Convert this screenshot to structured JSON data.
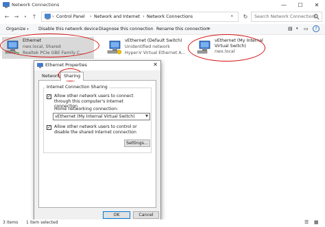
{
  "window": {
    "title": "Network Connections",
    "controls": {
      "minimize": "—",
      "maximize": "☐",
      "close": "✕"
    }
  },
  "address": {
    "breadcrumbs": [
      "Control Panel",
      "Network and Internet",
      "Network Connections"
    ],
    "search_placeholder": "Search Network Connections"
  },
  "toolbar": {
    "organize": "Organize",
    "disable": "Disable this network device",
    "diagnose": "Diagnose this connection",
    "rename": "Rename this connection"
  },
  "adapters": [
    {
      "name": "Ethernet",
      "status": "nwx.local, Shared",
      "device": "Realtek PCIe GBE Family C...",
      "selected": true
    },
    {
      "name": "vEthernet (Default Switch)",
      "status": "Unidentified network",
      "device": "Hyper-V Virtual Ethernet A...",
      "selected": false
    },
    {
      "name": "vEthernet (My Internal Virtual Switch)",
      "status": "nwx.local",
      "selected": false
    }
  ],
  "dialog": {
    "title": "Ethernet Properties",
    "tabs": [
      "Networking",
      "Sharing"
    ],
    "active_tab": "Sharing",
    "group_label": "Internet Connection Sharing",
    "allow_connect_label": "Allow other network users to connect through this computer's Internet connection",
    "allow_connect_checked": true,
    "home_label": "Home networking connection:",
    "home_value": "vEthernet (My Internal Virtual Switch)",
    "allow_control_label": "Allow other network users to control or disable the shared Internet connection",
    "allow_control_checked": true,
    "settings_button": "Settings...",
    "ok_button": "OK",
    "cancel_button": "Cancel"
  },
  "status": {
    "items": "3 items",
    "selected": "1 item selected"
  },
  "colors": {
    "selection": "#d9d9d9",
    "annotation_red": "#d20f0f",
    "default_button_border": "#0078d7"
  }
}
